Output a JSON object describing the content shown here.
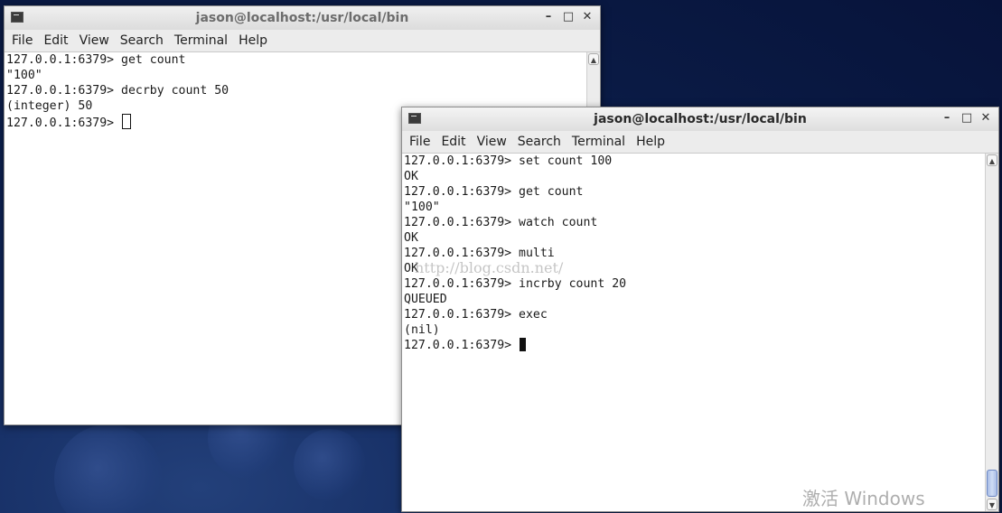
{
  "windows": {
    "left": {
      "title": "jason@localhost:/usr/local/bin",
      "menu": [
        "File",
        "Edit",
        "View",
        "Search",
        "Terminal",
        "Help"
      ],
      "lines": [
        "127.0.0.1:6379> get count",
        "\"100\"",
        "127.0.0.1:6379> decrby count 50",
        "(integer) 50",
        "127.0.0.1:6379> "
      ]
    },
    "right": {
      "title": "jason@localhost:/usr/local/bin",
      "menu": [
        "File",
        "Edit",
        "View",
        "Search",
        "Terminal",
        "Help"
      ],
      "lines": [
        "127.0.0.1:6379> set count 100",
        "OK",
        "127.0.0.1:6379> get count",
        "\"100\"",
        "127.0.0.1:6379> watch count",
        "OK",
        "127.0.0.1:6379> multi",
        "OK",
        "127.0.0.1:6379> incrby count 20",
        "QUEUED",
        "127.0.0.1:6379> exec",
        "(nil)",
        "127.0.0.1:6379> "
      ]
    }
  },
  "window_controls": {
    "minimize": "–",
    "maximize": "□",
    "close": "✕"
  },
  "scroll_arrows": {
    "up": "▲",
    "down": "▼"
  },
  "icons": {
    "window_icon": "terminal-icon",
    "minimize": "minimize-icon",
    "maximize": "maximize-icon",
    "close": "close-icon"
  },
  "watermark": "http://blog.csdn.net/",
  "activation_text": "激活 Windows"
}
